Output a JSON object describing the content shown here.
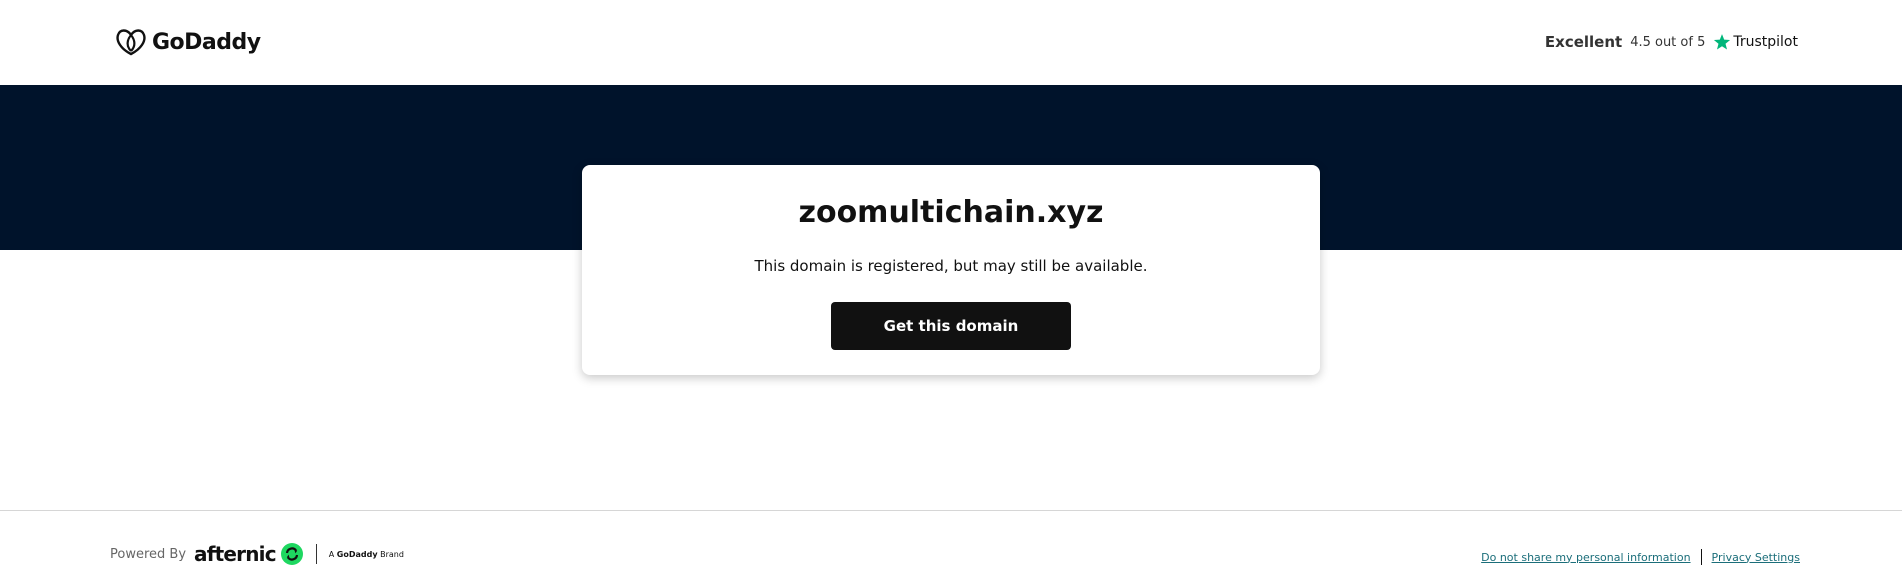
{
  "header": {
    "logo_text": "GoDaddy",
    "trustpilot": {
      "label": "Excellent",
      "rating": "4.5 out of 5",
      "brand": "Trustpilot"
    }
  },
  "card": {
    "domain": "zoomultichain.xyz",
    "status": "This domain is registered, but may still be available.",
    "cta_label": "Get this domain"
  },
  "footer": {
    "powered_by": "Powered By",
    "afternic": "afternic",
    "brand_prefix": "A",
    "brand_name": "GoDaddy",
    "brand_suffix": "Brand",
    "links": {
      "do_not_share": "Do not share my personal information",
      "privacy": "Privacy Settings"
    }
  },
  "colors": {
    "navy_band": "#00132b",
    "cta_background": "#111111",
    "trustpilot_star": "#00b67a",
    "afternic_green": "#1ed760",
    "link": "#1b6e7a"
  },
  "icons": {
    "logo": "godaddy-heart-icon",
    "star": "trustpilot-star-icon",
    "afternic": "afternic-refresh-icon"
  }
}
